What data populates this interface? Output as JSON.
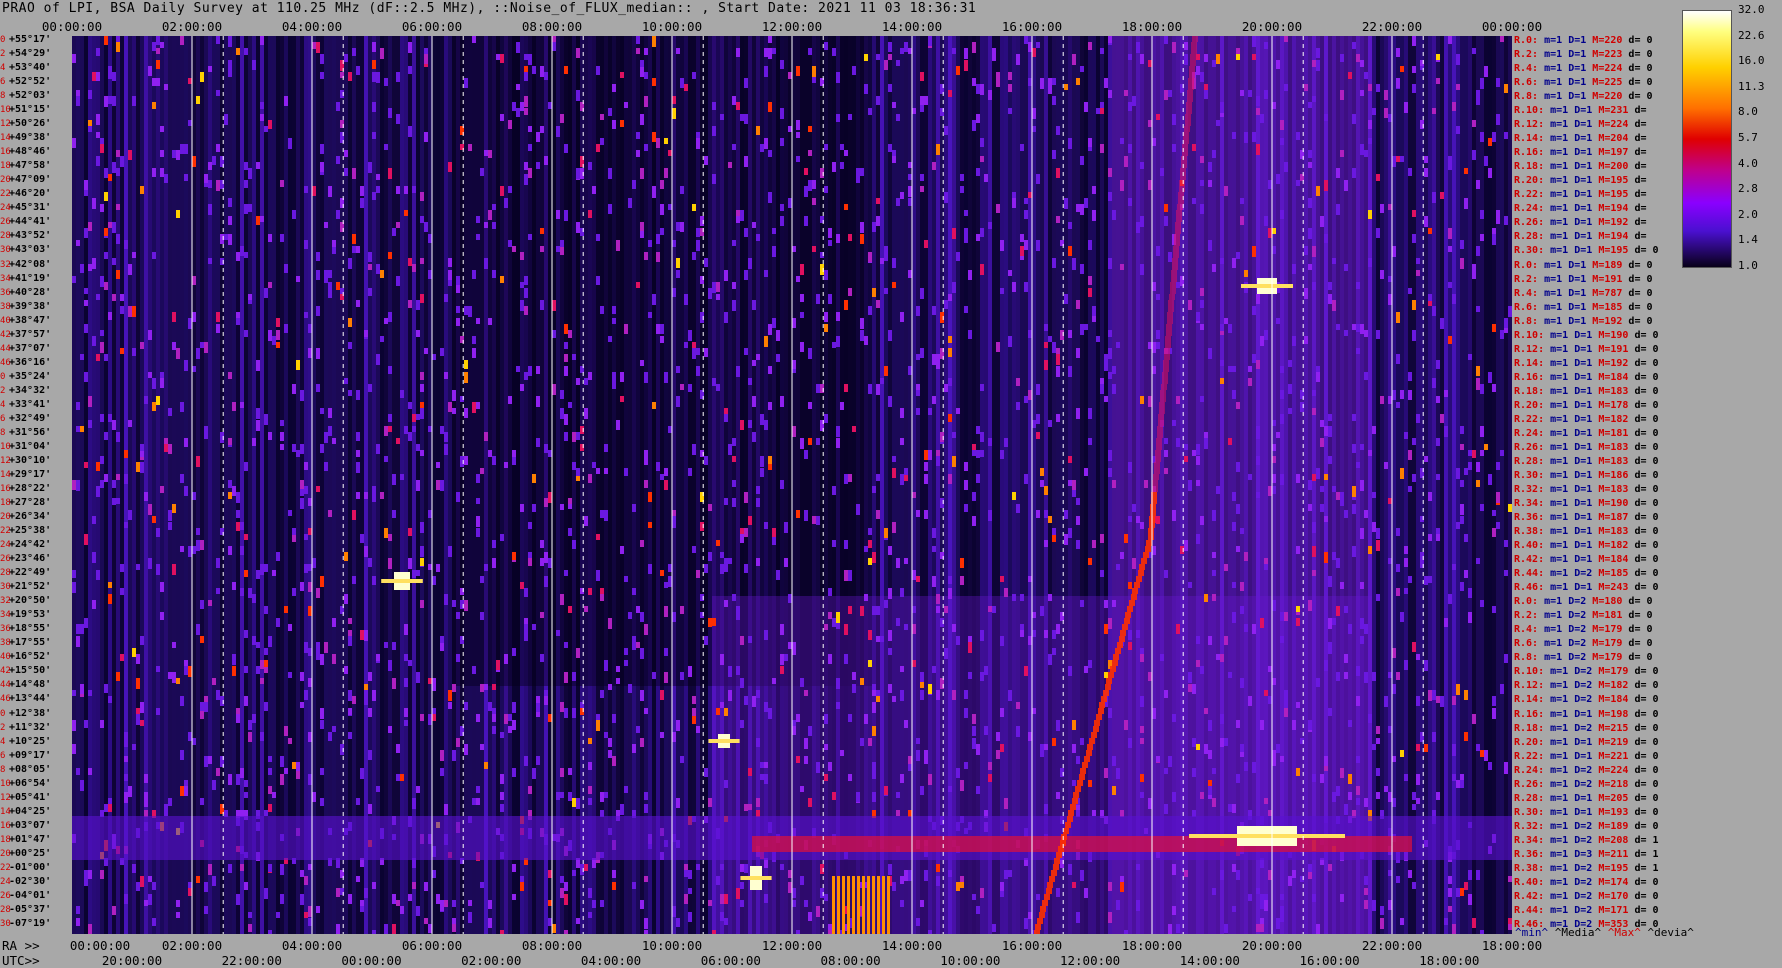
{
  "title": "PRAO of LPI, BSA Daily Survey at 110.25 MHz (dF::2.5 MHz), ::Noise_of_FLUX_median:: , Start Date: 2021 11 03 18:36:31",
  "chart_data": {
    "type": "heatmap",
    "title": "PRAO of LPI, BSA Daily Survey at 110.25 MHz (dF::2.5 MHz), ::Noise_of_FLUX_median:: , Start Date: 2021 11 03 18:36:31",
    "top_axis_ticks": [
      "00:00:00",
      "02:00:00",
      "04:00:00",
      "06:00:00",
      "08:00:00",
      "10:00:00",
      "12:00:00",
      "14:00:00",
      "16:00:00",
      "18:00:00",
      "20:00:00",
      "22:00:00",
      "00:00:00"
    ],
    "ra_axis_prefix": "RA >>",
    "ra_axis_ticks": [
      "00:00:00",
      "02:00:00",
      "04:00:00",
      "06:00:00",
      "08:00:00",
      "10:00:00",
      "12:00:00",
      "14:00:00",
      "16:00:00",
      "18:00:00",
      "20:00:00",
      "22:00:00",
      "18:00:00"
    ],
    "utc_axis_prefix": "UTC>>",
    "utc_axis_ticks": [
      "20:00:00",
      "22:00:00",
      "00:00:00",
      "02:00:00",
      "04:00:00",
      "06:00:00",
      "08:00:00",
      "10:00:00",
      "12:00:00",
      "14:00:00",
      "16:00:00",
      "18:00:00"
    ],
    "dec_labels": [
      {
        "idx": "0",
        "dec": "+55°17'"
      },
      {
        "idx": "2",
        "dec": "+54°29'"
      },
      {
        "idx": "4",
        "dec": "+53°40'"
      },
      {
        "idx": "6",
        "dec": "+52°52'"
      },
      {
        "idx": "8",
        "dec": "+52°03'"
      },
      {
        "idx": "10",
        "dec": "+51°15'"
      },
      {
        "idx": "12",
        "dec": "+50°26'"
      },
      {
        "idx": "14",
        "dec": "+49°38'"
      },
      {
        "idx": "16",
        "dec": "+48°46'"
      },
      {
        "idx": "18",
        "dec": "+47°58'"
      },
      {
        "idx": "20",
        "dec": "+47°09'"
      },
      {
        "idx": "22",
        "dec": "+46°20'"
      },
      {
        "idx": "24",
        "dec": "+45°31'"
      },
      {
        "idx": "26",
        "dec": "+44°41'"
      },
      {
        "idx": "28",
        "dec": "+43°52'"
      },
      {
        "idx": "30",
        "dec": "+43°03'"
      },
      {
        "idx": "32",
        "dec": "+42°08'"
      },
      {
        "idx": "34",
        "dec": "+41°19'"
      },
      {
        "idx": "36",
        "dec": "+40°28'"
      },
      {
        "idx": "38",
        "dec": "+39°38'"
      },
      {
        "idx": "40",
        "dec": "+38°47'"
      },
      {
        "idx": "42",
        "dec": "+37°57'"
      },
      {
        "idx": "44",
        "dec": "+37°07'"
      },
      {
        "idx": "46",
        "dec": "+36°16'"
      },
      {
        "idx": "0",
        "dec": "+35°24'"
      },
      {
        "idx": "2",
        "dec": "+34°32'"
      },
      {
        "idx": "4",
        "dec": "+33°41'"
      },
      {
        "idx": "6",
        "dec": "+32°49'"
      },
      {
        "idx": "8",
        "dec": "+31°56'"
      },
      {
        "idx": "10",
        "dec": "+31°04'"
      },
      {
        "idx": "12",
        "dec": "+30°10'"
      },
      {
        "idx": "14",
        "dec": "+29°17'"
      },
      {
        "idx": "16",
        "dec": "+28°22'"
      },
      {
        "idx": "18",
        "dec": "+27°28'"
      },
      {
        "idx": "20",
        "dec": "+26°34'"
      },
      {
        "idx": "22",
        "dec": "+25°38'"
      },
      {
        "idx": "24",
        "dec": "+24°42'"
      },
      {
        "idx": "26",
        "dec": "+23°46'"
      },
      {
        "idx": "28",
        "dec": "+22°49'"
      },
      {
        "idx": "30",
        "dec": "+21°52'"
      },
      {
        "idx": "32",
        "dec": "+20°50'"
      },
      {
        "idx": "34",
        "dec": "+19°53'"
      },
      {
        "idx": "36",
        "dec": "+18°55'"
      },
      {
        "idx": "38",
        "dec": "+17°55'"
      },
      {
        "idx": "40",
        "dec": "+16°52'"
      },
      {
        "idx": "42",
        "dec": "+15°50'"
      },
      {
        "idx": "44",
        "dec": "+14°48'"
      },
      {
        "idx": "46",
        "dec": "+13°44'"
      },
      {
        "idx": "0",
        "dec": "+12°38'"
      },
      {
        "idx": "2",
        "dec": "+11°32'"
      },
      {
        "idx": "4",
        "dec": "+10°25'"
      },
      {
        "idx": "6",
        "dec": "+09°17'"
      },
      {
        "idx": "8",
        "dec": "+08°05'"
      },
      {
        "idx": "10",
        "dec": "+06°54'"
      },
      {
        "idx": "12",
        "dec": "+05°41'"
      },
      {
        "idx": "14",
        "dec": "+04°25'"
      },
      {
        "idx": "16",
        "dec": "+03°07'"
      },
      {
        "idx": "18",
        "dec": "+01°47'"
      },
      {
        "idx": "20",
        "dec": "+00°25'"
      },
      {
        "idx": "22",
        "dec": "-01°00'"
      },
      {
        "idx": "24",
        "dec": "-02°30'"
      },
      {
        "idx": "26",
        "dec": "-04°01'"
      },
      {
        "idx": "28",
        "dec": "-05°37'"
      },
      {
        "idx": "30",
        "dec": "-07°19'"
      }
    ],
    "right_stats": [
      {
        "r": "R.0:",
        "m": "1",
        "d": "1",
        "M": "220",
        "dv": "0"
      },
      {
        "r": "R.2:",
        "m": "1",
        "d": "1",
        "M": "223",
        "dv": "0"
      },
      {
        "r": "R.4:",
        "m": "1",
        "d": "1",
        "M": "224",
        "dv": "0"
      },
      {
        "r": "R.6:",
        "m": "1",
        "d": "1",
        "M": "225",
        "dv": "0"
      },
      {
        "r": "R.8:",
        "m": "1",
        "d": "1",
        "M": "220",
        "dv": "0"
      },
      {
        "r": "R.10:",
        "m": "1",
        "d": "1",
        "M": "231",
        "dv": ""
      },
      {
        "r": "R.12:",
        "m": "1",
        "d": "1",
        "M": "224",
        "dv": ""
      },
      {
        "r": "R.14:",
        "m": "1",
        "d": "1",
        "M": "204",
        "dv": ""
      },
      {
        "r": "R.16:",
        "m": "1",
        "d": "1",
        "M": "197",
        "dv": ""
      },
      {
        "r": "R.18:",
        "m": "1",
        "d": "1",
        "M": "200",
        "dv": ""
      },
      {
        "r": "R.20:",
        "m": "1",
        "d": "1",
        "M": "195",
        "dv": ""
      },
      {
        "r": "R.22:",
        "m": "1",
        "d": "1",
        "M": "195",
        "dv": ""
      },
      {
        "r": "R.24:",
        "m": "1",
        "d": "1",
        "M": "194",
        "dv": ""
      },
      {
        "r": "R.26:",
        "m": "1",
        "d": "1",
        "M": "192",
        "dv": ""
      },
      {
        "r": "R.28:",
        "m": "1",
        "d": "1",
        "M": "194",
        "dv": ""
      },
      {
        "r": "R.30:",
        "m": "1",
        "d": "1",
        "M": "195",
        "dv": "0"
      },
      {
        "r": "R.0:",
        "m": "1",
        "d": "1",
        "M": "189",
        "dv": "0"
      },
      {
        "r": "R.2:",
        "m": "1",
        "d": "1",
        "M": "191",
        "dv": "0"
      },
      {
        "r": "R.4:",
        "m": "1",
        "d": "1",
        "M": "787",
        "dv": "0"
      },
      {
        "r": "R.6:",
        "m": "1",
        "d": "1",
        "M": "185",
        "dv": "0"
      },
      {
        "r": "R.8:",
        "m": "1",
        "d": "1",
        "M": "192",
        "dv": "0"
      },
      {
        "r": "R.10:",
        "m": "1",
        "d": "1",
        "M": "190",
        "dv": "0"
      },
      {
        "r": "R.12:",
        "m": "1",
        "d": "1",
        "M": "191",
        "dv": "0"
      },
      {
        "r": "R.14:",
        "m": "1",
        "d": "1",
        "M": "192",
        "dv": "0"
      },
      {
        "r": "R.16:",
        "m": "1",
        "d": "1",
        "M": "184",
        "dv": "0"
      },
      {
        "r": "R.18:",
        "m": "1",
        "d": "1",
        "M": "183",
        "dv": "0"
      },
      {
        "r": "R.20:",
        "m": "1",
        "d": "1",
        "M": "178",
        "dv": "0"
      },
      {
        "r": "R.22:",
        "m": "1",
        "d": "1",
        "M": "182",
        "dv": "0"
      },
      {
        "r": "R.24:",
        "m": "1",
        "d": "1",
        "M": "181",
        "dv": "0"
      },
      {
        "r": "R.26:",
        "m": "1",
        "d": "1",
        "M": "183",
        "dv": "0"
      },
      {
        "r": "R.28:",
        "m": "1",
        "d": "1",
        "M": "183",
        "dv": "0"
      },
      {
        "r": "R.30:",
        "m": "1",
        "d": "1",
        "M": "186",
        "dv": "0"
      },
      {
        "r": "R.32:",
        "m": "1",
        "d": "1",
        "M": "183",
        "dv": "0"
      },
      {
        "r": "R.34:",
        "m": "1",
        "d": "1",
        "M": "190",
        "dv": "0"
      },
      {
        "r": "R.36:",
        "m": "1",
        "d": "1",
        "M": "187",
        "dv": "0"
      },
      {
        "r": "R.38:",
        "m": "1",
        "d": "1",
        "M": "183",
        "dv": "0"
      },
      {
        "r": "R.40:",
        "m": "1",
        "d": "1",
        "M": "182",
        "dv": "0"
      },
      {
        "r": "R.42:",
        "m": "1",
        "d": "1",
        "M": "184",
        "dv": "0"
      },
      {
        "r": "R.44:",
        "m": "1",
        "d": "2",
        "M": "185",
        "dv": "0"
      },
      {
        "r": "R.46:",
        "m": "1",
        "d": "1",
        "M": "243",
        "dv": "0"
      },
      {
        "r": "R.0:",
        "m": "1",
        "d": "2",
        "M": "180",
        "dv": "0"
      },
      {
        "r": "R.2:",
        "m": "1",
        "d": "2",
        "M": "181",
        "dv": "0"
      },
      {
        "r": "R.4:",
        "m": "1",
        "d": "2",
        "M": "179",
        "dv": "0"
      },
      {
        "r": "R.6:",
        "m": "1",
        "d": "2",
        "M": "179",
        "dv": "0"
      },
      {
        "r": "R.8:",
        "m": "1",
        "d": "2",
        "M": "179",
        "dv": "0"
      },
      {
        "r": "R.10:",
        "m": "1",
        "d": "2",
        "M": "179",
        "dv": "0"
      },
      {
        "r": "R.12:",
        "m": "1",
        "d": "2",
        "M": "182",
        "dv": "0"
      },
      {
        "r": "R.14:",
        "m": "1",
        "d": "2",
        "M": "184",
        "dv": "0"
      },
      {
        "r": "R.16:",
        "m": "1",
        "d": "1",
        "M": "198",
        "dv": "0"
      },
      {
        "r": "R.18:",
        "m": "1",
        "d": "2",
        "M": "215",
        "dv": "0"
      },
      {
        "r": "R.20:",
        "m": "1",
        "d": "1",
        "M": "219",
        "dv": "0"
      },
      {
        "r": "R.22:",
        "m": "1",
        "d": "1",
        "M": "221",
        "dv": "0"
      },
      {
        "r": "R.24:",
        "m": "1",
        "d": "2",
        "M": "224",
        "dv": "0"
      },
      {
        "r": "R.26:",
        "m": "1",
        "d": "2",
        "M": "218",
        "dv": "0"
      },
      {
        "r": "R.28:",
        "m": "1",
        "d": "1",
        "M": "205",
        "dv": "0"
      },
      {
        "r": "R.30:",
        "m": "1",
        "d": "1",
        "M": "193",
        "dv": "0"
      },
      {
        "r": "R.32:",
        "m": "1",
        "d": "2",
        "M": "189",
        "dv": "0"
      },
      {
        "r": "R.34:",
        "m": "1",
        "d": "2",
        "M": "208",
        "dv": "1"
      },
      {
        "r": "R.36:",
        "m": "1",
        "d": "3",
        "M": "211",
        "dv": "1"
      },
      {
        "r": "R.38:",
        "m": "1",
        "d": "2",
        "M": "195",
        "dv": "1"
      },
      {
        "r": "R.40:",
        "m": "1",
        "d": "2",
        "M": "174",
        "dv": "0"
      },
      {
        "r": "R.42:",
        "m": "1",
        "d": "2",
        "M": "170",
        "dv": "0"
      },
      {
        "r": "R.44:",
        "m": "1",
        "d": "2",
        "M": "171",
        "dv": "0"
      },
      {
        "r": "R.46:",
        "m": "1",
        "d": "2",
        "M": "353",
        "dv": "0"
      }
    ],
    "legend_bottom": {
      "min": "^min^",
      "median": "^Media^",
      "max": "^Max^",
      "devia": "^devia^"
    },
    "colorbar": {
      "ticks": [
        "32.0",
        "22.6",
        "16.0",
        "11.3",
        "8.0",
        "5.7",
        "4.0",
        "2.8",
        "2.0",
        "1.4",
        "1.0"
      ],
      "colors": [
        "#ffffff",
        "#ffff80",
        "#ffd000",
        "#ff7000",
        "#e00000",
        "#c0008a",
        "#8a00ff",
        "#4a10d0",
        "#080018"
      ]
    },
    "noise_range": [
      1.0,
      32.0
    ],
    "time_range_hours": [
      0,
      24
    ]
  }
}
